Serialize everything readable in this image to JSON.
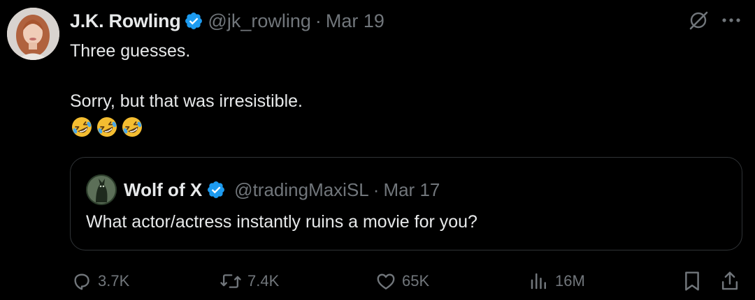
{
  "tweet": {
    "author": {
      "name": "J.K. Rowling",
      "handle": "@jk_rowling",
      "separator": "·",
      "date": "Mar 19"
    },
    "text": {
      "line1": "Three guesses.",
      "line2": "Sorry, but that was irresistible.",
      "emojis": [
        "🤣",
        "🤣",
        "🤣"
      ]
    },
    "quoted": {
      "name": "Wolf of X",
      "handle": "@tradingMaxiSL",
      "separator": "·",
      "date": "Mar 17",
      "text": "What actor/actress instantly ruins a movie for you?"
    },
    "actions": {
      "replies": "3.7K",
      "reposts": "7.4K",
      "likes": "65K",
      "views": "16M"
    },
    "icons": {
      "verified": "verified-badge-icon",
      "grok": "grok-icon",
      "more": "more-icon",
      "reply": "reply-icon",
      "repost": "repost-icon",
      "like": "heart-icon",
      "views": "views-icon",
      "bookmark": "bookmark-icon",
      "share": "share-icon"
    },
    "colors": {
      "background": "#000000",
      "text": "#e7e9ea",
      "muted": "#71767b",
      "verified": "#1d9bf0",
      "border": "#2f3336"
    }
  }
}
